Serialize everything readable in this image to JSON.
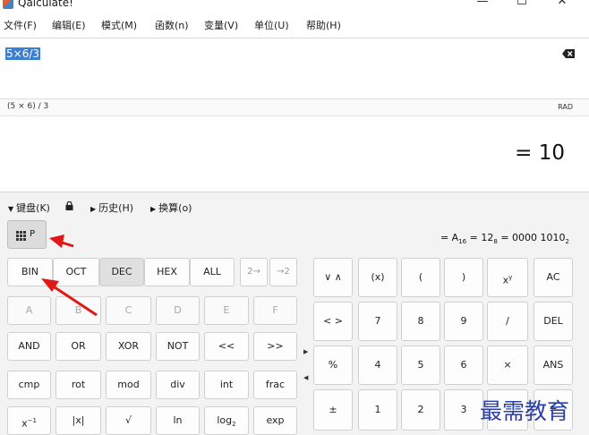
{
  "window": {
    "title": "Qalculate!",
    "minimize_label": "—",
    "maximize_label": "☐",
    "close_label": "✕"
  },
  "menu": [
    "文件(F)",
    "编辑(E)",
    "模式(M)",
    "函数(n)",
    "变量(V)",
    "单位(U)",
    "帮助(H)"
  ],
  "expression": {
    "value": "5×6/3",
    "clear_icon": "backspace-icon"
  },
  "status": {
    "parsed": "(5 × 6) / 3",
    "angle_mode": "RAD"
  },
  "result": "= 10",
  "sections": {
    "keyboard": "键盘(K)",
    "history": "历史(H)",
    "conversion": "换算(o)"
  },
  "programming": {
    "p_button": "P",
    "base_readout": {
      "prefix": "= A",
      "hex_sub": "16",
      "mid": " = 12",
      "oct_sub": "8",
      "suffix": " = 0000 1010",
      "bin_sub": "2"
    }
  },
  "base_buttons": [
    "BIN",
    "OCT",
    "DEC",
    "HEX",
    "ALL"
  ],
  "base_arrows": [
    "2→",
    "→2"
  ],
  "hex_digits": [
    "A",
    "B",
    "C",
    "D",
    "E",
    "F"
  ],
  "prog_row1": [
    "AND",
    "OR",
    "XOR",
    "NOT",
    "<<",
    ">>"
  ],
  "prog_row2": [
    "cmp",
    "rot",
    "mod",
    "div",
    "int",
    "frac"
  ],
  "prog_row3": {
    "xinv": "x",
    "xinv_sup": "−1",
    "abs": "|x|",
    "sqrt": "√",
    "ln": "ln",
    "log2": "log",
    "log2_sub": "2",
    "exp": "exp"
  },
  "keypad": {
    "nav1": [
      "∨",
      "∧"
    ],
    "nav2": [
      "<",
      ">"
    ],
    "row1": [
      "(x)",
      "(",
      ")"
    ],
    "xy": "x",
    "xy_sup": "y",
    "ac": "AC",
    "row2": [
      "7",
      "8",
      "9",
      "∕",
      "DEL"
    ],
    "row3": [
      "%",
      "4",
      "5",
      "6",
      "×",
      "ANS"
    ],
    "row4": [
      "±",
      "1",
      "2",
      "3",
      "",
      "="
    ]
  },
  "watermark": "最需教育"
}
